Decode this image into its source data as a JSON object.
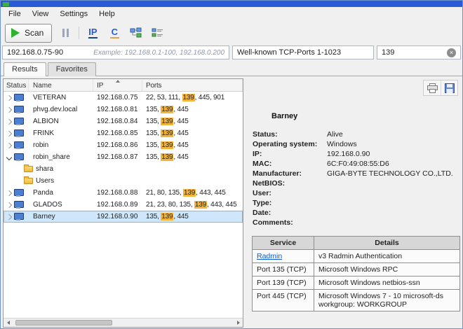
{
  "colors": {
    "accent": "#2a5bd7",
    "green": "#2fb32f",
    "highlight": "#f3b43a",
    "selection": "#cfe7fb",
    "link": "#0b5bd3"
  },
  "menu": {
    "items": [
      "File",
      "View",
      "Settings",
      "Help"
    ]
  },
  "toolbar": {
    "scan_label": "Scan",
    "ip_icon": "IP",
    "c_icon": "C"
  },
  "search": {
    "range_value": "192.168.0.75-90",
    "range_hint": "Example: 192.168.0.1-100, 192.168.0.200",
    "ports_value": "Well-known TCP-Ports 1-1023",
    "filter_value": "139",
    "clear_glyph": "×"
  },
  "tabs": [
    {
      "label": "Results",
      "active": true
    },
    {
      "label": "Favorites",
      "active": false
    }
  ],
  "results": {
    "columns": [
      "Status",
      "Name",
      "IP",
      "Ports"
    ],
    "sort_column": "IP",
    "highlight_port": "139",
    "rows": [
      {
        "kind": "host",
        "state": "collapsed",
        "name": "VETERAN",
        "ip": "192.168.0.75",
        "ports": "22, 53, 111, 139, 445, 901"
      },
      {
        "kind": "host",
        "state": "collapsed",
        "name": "phvg.dev.local",
        "ip": "192.168.0.81",
        "ports": "135, 139, 445"
      },
      {
        "kind": "host",
        "state": "collapsed",
        "name": "ALBION",
        "ip": "192.168.0.84",
        "ports": "135, 139, 445"
      },
      {
        "kind": "host",
        "state": "collapsed",
        "name": "FRINK",
        "ip": "192.168.0.85",
        "ports": "135, 139, 445"
      },
      {
        "kind": "host",
        "state": "collapsed",
        "name": "robin",
        "ip": "192.168.0.86",
        "ports": "135, 139, 445"
      },
      {
        "kind": "host",
        "state": "expanded",
        "name": "robin_share",
        "ip": "192.168.0.87",
        "ports": "135, 139, 445"
      },
      {
        "kind": "folder",
        "name": "shara"
      },
      {
        "kind": "folder",
        "name": "Users"
      },
      {
        "kind": "host",
        "state": "collapsed",
        "name": "Panda",
        "ip": "192.168.0.88",
        "ports": "21, 80, 135, 139, 443, 445"
      },
      {
        "kind": "host",
        "state": "collapsed",
        "name": "GLADOS",
        "ip": "192.168.0.89",
        "ports": "21, 23, 80, 135, 139, 443, 445"
      },
      {
        "kind": "host",
        "state": "collapsed",
        "name": "Barney",
        "ip": "192.168.0.90",
        "ports": "135, 139, 445",
        "selected": true
      }
    ]
  },
  "details": {
    "host_name": "Barney",
    "fields": [
      {
        "label": "Status:",
        "value": "Alive"
      },
      {
        "label": "Operating system:",
        "value": "Windows"
      },
      {
        "label": "IP:",
        "value": "192.168.0.90"
      },
      {
        "label": "MAC:",
        "value": "6C:F0:49:08:55:D6"
      },
      {
        "label": "Manufacturer:",
        "value": "GIGA-BYTE TECHNOLOGY CO.,LTD."
      },
      {
        "label": "NetBIOS:",
        "value": ""
      },
      {
        "label": "User:",
        "value": ""
      },
      {
        "label": "Type:",
        "value": ""
      },
      {
        "label": "Date:",
        "value": ""
      },
      {
        "label": "Comments:",
        "value": ""
      }
    ],
    "services": {
      "columns": [
        "Service",
        "Details"
      ],
      "rows": [
        {
          "service": "Radmin",
          "link": true,
          "details": "v3 Radmin Authentication"
        },
        {
          "service": "Port 135 (TCP)",
          "link": false,
          "details": "Microsoft Windows RPC"
        },
        {
          "service": "Port 139 (TCP)",
          "link": false,
          "details": "Microsoft Windows netbios-ssn"
        },
        {
          "service": "Port 445 (TCP)",
          "link": false,
          "details": "Microsoft Windows 7 - 10 microsoft-ds workgroup: WORKGROUP"
        }
      ]
    }
  }
}
